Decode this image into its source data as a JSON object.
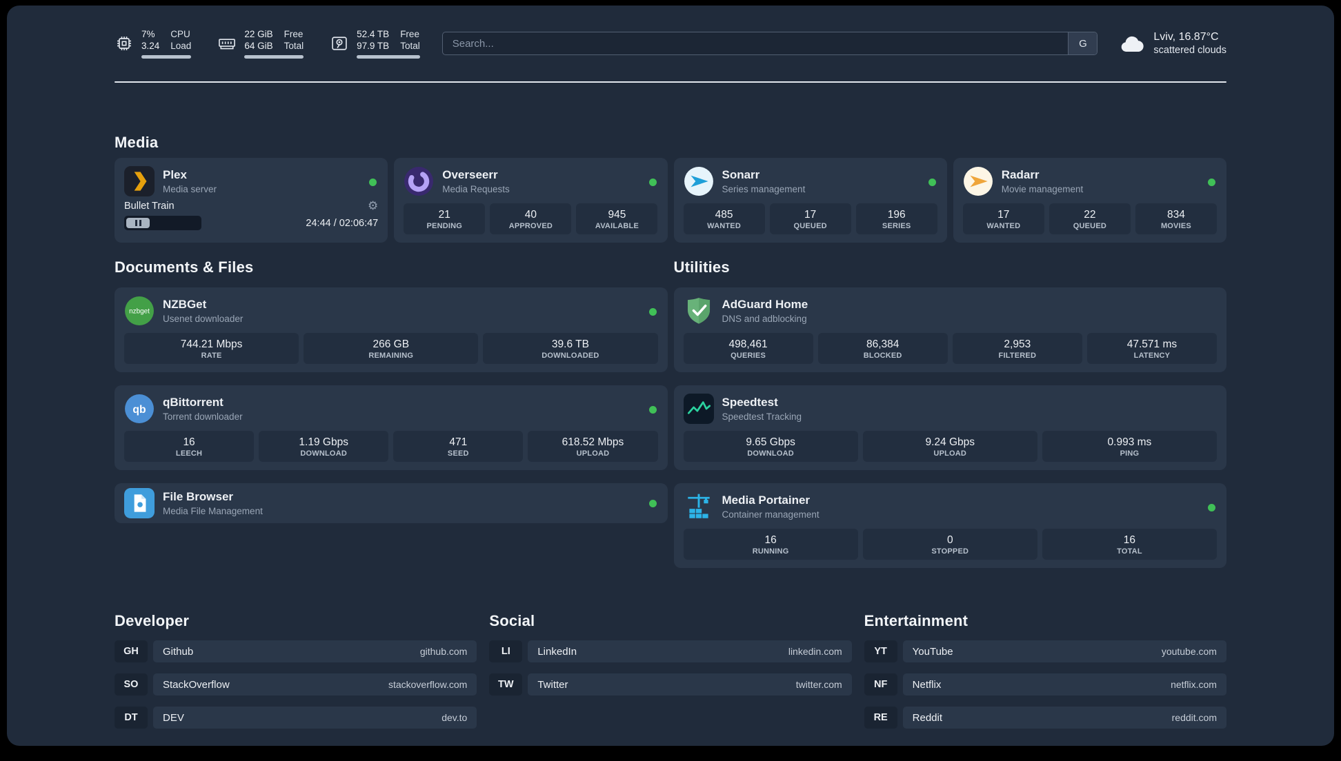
{
  "header": {
    "cpu": {
      "value_top": "7%",
      "value_bottom": "3.24",
      "label_top": "CPU",
      "label_bottom": "Load"
    },
    "ram": {
      "value_top": "22 GiB",
      "value_bottom": "64 GiB",
      "label_top": "Free",
      "label_bottom": "Total"
    },
    "disk": {
      "value_top": "52.4 TB",
      "value_bottom": "97.9 TB",
      "label_top": "Free",
      "label_bottom": "Total"
    },
    "search": {
      "placeholder": "Search...",
      "button": "G"
    },
    "weather": {
      "location": "Lviv, 16.87°C",
      "condition": "scattered clouds"
    }
  },
  "sections": {
    "media": "Media",
    "documents": "Documents & Files",
    "utilities": "Utilities",
    "developer": "Developer",
    "social": "Social",
    "entertainment": "Entertainment"
  },
  "cards": {
    "plex": {
      "name": "Plex",
      "subtitle": "Media server",
      "now_playing": "Bullet Train",
      "time": "24:44 / 02:06:47"
    },
    "overseerr": {
      "name": "Overseerr",
      "subtitle": "Media Requests",
      "stats": [
        {
          "value": "21",
          "label": "PENDING"
        },
        {
          "value": "40",
          "label": "APPROVED"
        },
        {
          "value": "945",
          "label": "AVAILABLE"
        }
      ]
    },
    "sonarr": {
      "name": "Sonarr",
      "subtitle": "Series management",
      "stats": [
        {
          "value": "485",
          "label": "WANTED"
        },
        {
          "value": "17",
          "label": "QUEUED"
        },
        {
          "value": "196",
          "label": "SERIES"
        }
      ]
    },
    "radarr": {
      "name": "Radarr",
      "subtitle": "Movie management",
      "stats": [
        {
          "value": "17",
          "label": "WANTED"
        },
        {
          "value": "22",
          "label": "QUEUED"
        },
        {
          "value": "834",
          "label": "MOVIES"
        }
      ]
    },
    "nzbget": {
      "name": "NZBGet",
      "subtitle": "Usenet downloader",
      "stats": [
        {
          "value": "744.21 Mbps",
          "label": "RATE"
        },
        {
          "value": "266 GB",
          "label": "REMAINING"
        },
        {
          "value": "39.6 TB",
          "label": "DOWNLOADED"
        }
      ]
    },
    "qbittorrent": {
      "name": "qBittorrent",
      "subtitle": "Torrent downloader",
      "stats": [
        {
          "value": "16",
          "label": "LEECH"
        },
        {
          "value": "1.19 Gbps",
          "label": "DOWNLOAD"
        },
        {
          "value": "471",
          "label": "SEED"
        },
        {
          "value": "618.52 Mbps",
          "label": "UPLOAD"
        }
      ]
    },
    "filebrowser": {
      "name": "File Browser",
      "subtitle": "Media File Management"
    },
    "adguard": {
      "name": "AdGuard Home",
      "subtitle": "DNS and adblocking",
      "stats": [
        {
          "value": "498,461",
          "label": "QUERIES"
        },
        {
          "value": "86,384",
          "label": "BLOCKED"
        },
        {
          "value": "2,953",
          "label": "FILTERED"
        },
        {
          "value": "47.571 ms",
          "label": "LATENCY"
        }
      ]
    },
    "speedtest": {
      "name": "Speedtest",
      "subtitle": "Speedtest Tracking",
      "stats": [
        {
          "value": "9.65 Gbps",
          "label": "DOWNLOAD"
        },
        {
          "value": "9.24 Gbps",
          "label": "UPLOAD"
        },
        {
          "value": "0.993 ms",
          "label": "PING"
        }
      ]
    },
    "portainer": {
      "name": "Media Portainer",
      "subtitle": "Container management",
      "stats": [
        {
          "value": "16",
          "label": "RUNNING"
        },
        {
          "value": "0",
          "label": "STOPPED"
        },
        {
          "value": "16",
          "label": "TOTAL"
        }
      ]
    }
  },
  "bookmarks": {
    "developer": [
      {
        "abbr": "GH",
        "name": "Github",
        "url": "github.com"
      },
      {
        "abbr": "SO",
        "name": "StackOverflow",
        "url": "stackoverflow.com"
      },
      {
        "abbr": "DT",
        "name": "DEV",
        "url": "dev.to"
      }
    ],
    "social": [
      {
        "abbr": "LI",
        "name": "LinkedIn",
        "url": "linkedin.com"
      },
      {
        "abbr": "TW",
        "name": "Twitter",
        "url": "twitter.com"
      }
    ],
    "entertainment": [
      {
        "abbr": "YT",
        "name": "YouTube",
        "url": "youtube.com"
      },
      {
        "abbr": "NF",
        "name": "Netflix",
        "url": "netflix.com"
      },
      {
        "abbr": "RE",
        "name": "Reddit",
        "url": "reddit.com"
      }
    ]
  },
  "colors": {
    "status_online": "#40c057",
    "plex_gold": "#e5a00d",
    "overseerr_purple": "#b5a2f5",
    "sonarr_blue": "#1f9fd8",
    "radarr_amber": "#efa53a",
    "nzbget_green": "#43a047",
    "qbittorrent_blue": "#4b8fd5",
    "filebrowser_blue": "#3f9ddc",
    "adguard_green": "#68b279",
    "speedtest_green": "#2bd3a0",
    "portainer_blue": "#2cb4e8"
  }
}
